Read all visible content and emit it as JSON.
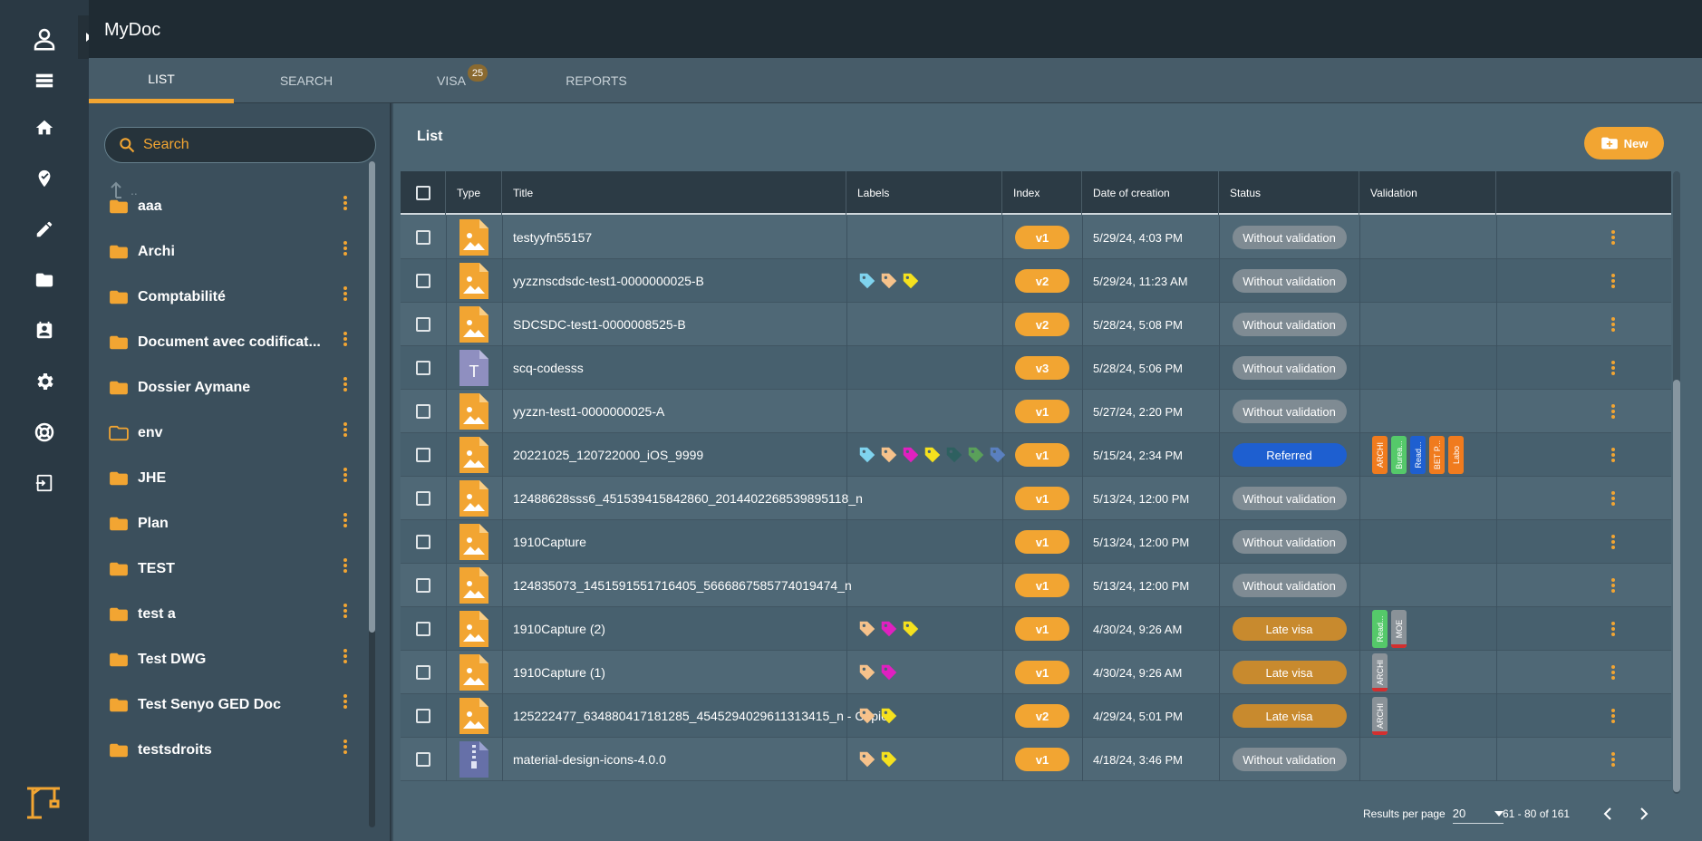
{
  "app": {
    "title": "MyDoc"
  },
  "rail": {
    "icons": [
      "person-icon",
      "list-icon",
      "home-icon",
      "verified-icon",
      "pencil-icon",
      "folder-icon",
      "contact-icon",
      "gear-icon",
      "lifebuoy-icon",
      "logout-icon",
      "crane-logo-icon"
    ]
  },
  "tabs": [
    {
      "label": "LIST",
      "active": true
    },
    {
      "label": "SEARCH",
      "active": false
    },
    {
      "label": "VISA",
      "active": false,
      "badge": "25"
    },
    {
      "label": "REPORTS",
      "active": false
    }
  ],
  "sidebar": {
    "search_placeholder": "Search",
    "parent_label": "..",
    "folders": [
      {
        "name": "aaa",
        "outlined": false
      },
      {
        "name": "Archi",
        "outlined": false
      },
      {
        "name": "Comptabilité",
        "outlined": false
      },
      {
        "name": "Document avec codificat...",
        "outlined": false
      },
      {
        "name": "Dossier Aymane",
        "outlined": false
      },
      {
        "name": "env",
        "outlined": true
      },
      {
        "name": "JHE",
        "outlined": false
      },
      {
        "name": "Plan",
        "outlined": false
      },
      {
        "name": "TEST",
        "outlined": false
      },
      {
        "name": "test a",
        "outlined": false
      },
      {
        "name": "Test DWG",
        "outlined": false
      },
      {
        "name": "Test Senyo GED Doc",
        "outlined": false
      },
      {
        "name": "testsdroits",
        "outlined": false
      }
    ]
  },
  "main": {
    "title": "List",
    "new_label": "New",
    "columns": [
      "Type",
      "Title",
      "Labels",
      "Index",
      "Date of creation",
      "Status",
      "Validation"
    ],
    "rows": [
      {
        "type": "image",
        "title": "testyyfn55157",
        "labels": [],
        "index": "v1",
        "date": "5/29/24, 4:03 PM",
        "status": "Without validation",
        "validation": []
      },
      {
        "type": "image",
        "title": "yyzznscdsdc-test1-0000000025-B",
        "labels": [
          "#7fd3ee",
          "#f6c28b",
          "#f5e11e"
        ],
        "index": "v2",
        "date": "5/29/24, 11:23 AM",
        "status": "Without validation",
        "validation": []
      },
      {
        "type": "image",
        "title": "SDCSDC-test1-0000008525-B",
        "labels": [],
        "index": "v2",
        "date": "5/28/24, 5:08 PM",
        "status": "Without validation",
        "validation": []
      },
      {
        "type": "text",
        "title": "scq-codesss",
        "labels": [],
        "index": "v3",
        "date": "5/28/24, 5:06 PM",
        "status": "Without validation",
        "validation": []
      },
      {
        "type": "image",
        "title": "yyzzn-test1-0000000025-A",
        "labels": [],
        "index": "v1",
        "date": "5/27/24, 2:20 PM",
        "status": "Without validation",
        "validation": []
      },
      {
        "type": "image",
        "title": "20221025_120722000_iOS_9999",
        "labels": [
          "#7fd3ee",
          "#f6c28b",
          "#e020c0",
          "#f5e11e",
          "#2e6060",
          "#5aa05a",
          "#5a80c0"
        ],
        "index": "v1",
        "date": "5/15/24, 2:34 PM",
        "status": "Referred",
        "validation": [
          {
            "label": "ARCHI",
            "color": "#f07b1e",
            "bar": false
          },
          {
            "label": "Burea...",
            "color": "#55c96a",
            "bar": false
          },
          {
            "label": "Read...",
            "color": "#1e5fd0",
            "bar": false
          },
          {
            "label": "BET P...",
            "color": "#f07b1e",
            "bar": false
          },
          {
            "label": "Labo",
            "color": "#f07b1e",
            "bar": false
          }
        ]
      },
      {
        "type": "image",
        "title": "12488628sss6_451539415842860_2014402268539895118_n",
        "labels": [],
        "index": "v1",
        "date": "5/13/24, 12:00 PM",
        "status": "Without validation",
        "validation": []
      },
      {
        "type": "image",
        "title": "1910Capture",
        "labels": [],
        "index": "v1",
        "date": "5/13/24, 12:00 PM",
        "status": "Without validation",
        "validation": []
      },
      {
        "type": "image",
        "title": "124835073_1451591551716405_5666867585774019474_n",
        "labels": [],
        "index": "v1",
        "date": "5/13/24, 12:00 PM",
        "status": "Without validation",
        "validation": []
      },
      {
        "type": "image",
        "title": "1910Capture (2)",
        "labels": [
          "#f6c28b",
          "#e020c0",
          "#f5e11e"
        ],
        "index": "v1",
        "date": "4/30/24, 9:26 AM",
        "status": "Late visa",
        "validation": [
          {
            "label": "Read...",
            "color": "#55c96a",
            "bar": false
          },
          {
            "label": "MOE",
            "color": "#8a9298",
            "bar": true
          }
        ]
      },
      {
        "type": "image",
        "title": "1910Capture (1)",
        "labels": [
          "#f6c28b",
          "#e020c0"
        ],
        "index": "v1",
        "date": "4/30/24, 9:26 AM",
        "status": "Late visa",
        "validation": [
          {
            "label": "ARCHI",
            "color": "#8a9298",
            "bar": true
          }
        ]
      },
      {
        "type": "image",
        "title": "125222477_634880417181285_4545294029611313415_n - Copie",
        "labels": [
          "#f6c28b",
          "#f5e11e"
        ],
        "index": "v2",
        "date": "4/29/24, 5:01 PM",
        "status": "Late visa",
        "validation": [
          {
            "label": "ARCHI",
            "color": "#8a9298",
            "bar": true
          }
        ]
      },
      {
        "type": "zip",
        "title": "material-design-icons-4.0.0",
        "labels": [
          "#f6c28b",
          "#f5e11e"
        ],
        "index": "v1",
        "date": "4/18/24, 3:46 PM",
        "status": "Without validation",
        "validation": []
      }
    ],
    "status_colors": {
      "Without validation": "#7f8b93",
      "Referred": "#1e5fd0",
      "Late visa": "#c88a2e"
    },
    "footer": {
      "rpp_label": "Results per page",
      "rpp_value": "20",
      "range": "61 - 80 of 161"
    }
  }
}
